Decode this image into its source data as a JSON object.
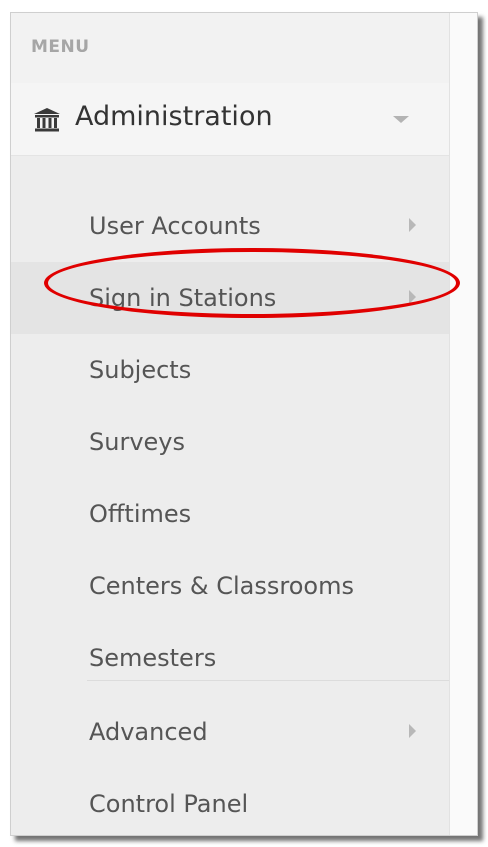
{
  "menu": {
    "heading": "MENU"
  },
  "admin": {
    "label": "Administration",
    "icon": "institution-icon"
  },
  "submenu": {
    "items": [
      {
        "label": "User Accounts",
        "has_children": true
      },
      {
        "label": "Sign in Stations",
        "has_children": true,
        "active": true
      },
      {
        "label": "Subjects"
      },
      {
        "label": "Surveys"
      },
      {
        "label": "Offtimes"
      },
      {
        "label": "Centers & Classrooms"
      },
      {
        "label": "Semesters"
      },
      {
        "label": "Advanced",
        "has_children": true
      },
      {
        "label": "Control Panel"
      }
    ]
  },
  "colors": {
    "annotation": "#e00000",
    "text": "#555555",
    "heading": "#a6a6a6"
  }
}
